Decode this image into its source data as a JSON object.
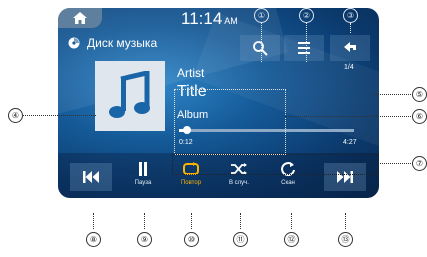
{
  "clock": {
    "time": "11:14",
    "ampm": "AM"
  },
  "source": {
    "title": "Диск музыка"
  },
  "top_buttons": {
    "page_indicator": "1/4"
  },
  "track": {
    "artist": "Artist",
    "title": "Title",
    "album": "Album",
    "elapsed": "0:12",
    "total": "4:27",
    "progress": 0.045
  },
  "controls": {
    "pause_label": "Пауза",
    "repeat_label": "Повтор",
    "shuffle_label": "В случ.",
    "scan_label": "Скан"
  },
  "colors": {
    "accent": "#ffb300",
    "screen_bg": "#155a98"
  },
  "callouts": {
    "c1": "①",
    "c2": "②",
    "c3": "③",
    "c4": "④",
    "c5": "⑤",
    "c6": "⑥",
    "c7": "⑦",
    "c8": "⑧",
    "c9": "⑨",
    "c10": "⑩",
    "c11": "⑪",
    "c12": "⑫",
    "c13": "⑬"
  }
}
